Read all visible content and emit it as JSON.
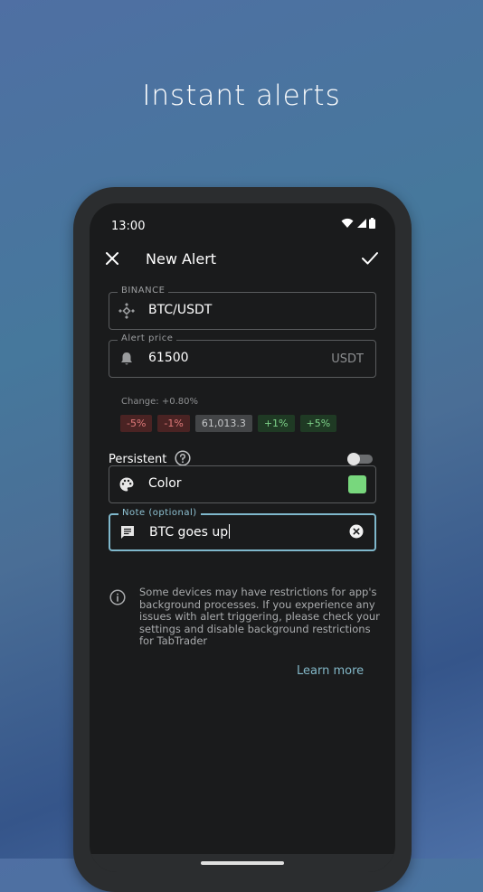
{
  "headline": "Instant alerts",
  "status_bar": {
    "time": "13:00",
    "icons": [
      "wifi-icon",
      "signal-icon",
      "battery-icon"
    ]
  },
  "appbar": {
    "title": "New Alert",
    "close_icon": "close-icon",
    "confirm_icon": "check-icon"
  },
  "exchange_field": {
    "label": "BINANCE",
    "value": "BTC/USDT",
    "icon": "binance-icon"
  },
  "price_field": {
    "label": "Alert price",
    "value": "61500",
    "suffix": "USDT",
    "icon": "bell-icon"
  },
  "change": {
    "label": "Change: +0.80%",
    "chips": [
      {
        "label": "-5%",
        "kind": "neg"
      },
      {
        "label": "-1%",
        "kind": "neg"
      },
      {
        "label": "61,013.3",
        "kind": "cur"
      },
      {
        "label": "+1%",
        "kind": "pos"
      },
      {
        "label": "+5%",
        "kind": "pos"
      }
    ]
  },
  "persistent": {
    "label": "Persistent",
    "enabled": false,
    "help_icon": "help-icon"
  },
  "color_field": {
    "label": "Color",
    "swatch": "#78d77d",
    "icon": "palette-icon"
  },
  "note_field": {
    "label": "Note (optional)",
    "value": "BTC goes up",
    "icon": "message-icon",
    "clear_icon": "clear-icon"
  },
  "info": {
    "text": "Some devices may have restrictions for app's background processes. If you experience any issues with alert triggering, please check your settings and disable background restrictions for TabTrader",
    "link": "Learn more"
  },
  "colors": {
    "accent": "#7fb8cc",
    "negative": "#e07a7a",
    "positive": "#7fd38a",
    "background": "#1a1b1c"
  }
}
